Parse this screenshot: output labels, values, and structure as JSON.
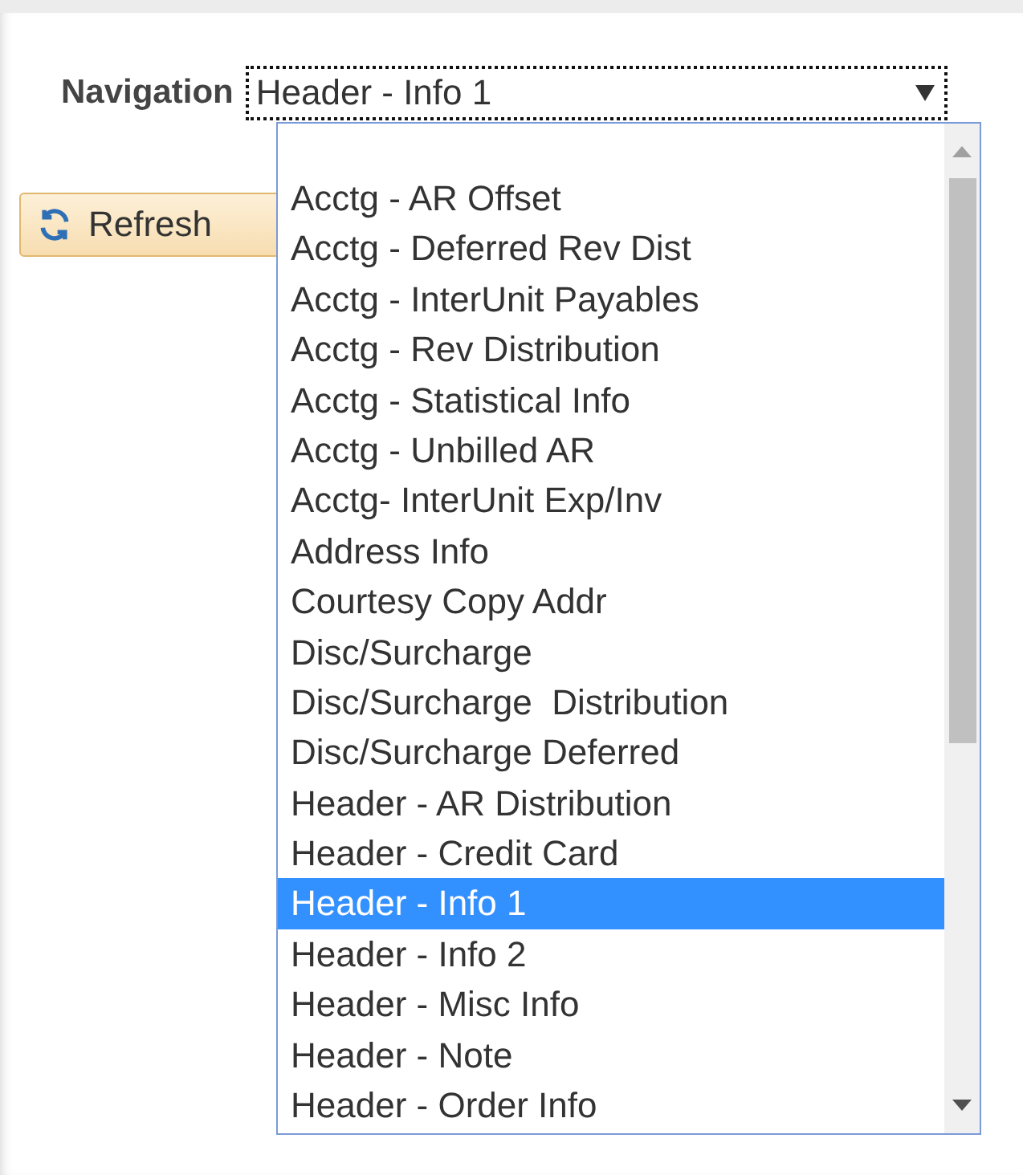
{
  "navigation": {
    "label": "Navigation",
    "value": "Header - Info 1"
  },
  "refresh_button": {
    "label": "Refresh"
  },
  "dropdown": {
    "options": [
      {
        "label": "Acctg - AR Offset",
        "selected": false
      },
      {
        "label": "Acctg - Deferred Rev Dist",
        "selected": false
      },
      {
        "label": "Acctg - InterUnit Payables",
        "selected": false
      },
      {
        "label": "Acctg - Rev Distribution",
        "selected": false
      },
      {
        "label": "Acctg - Statistical Info",
        "selected": false
      },
      {
        "label": "Acctg - Unbilled AR",
        "selected": false
      },
      {
        "label": "Acctg- InterUnit Exp/Inv",
        "selected": false
      },
      {
        "label": "Address Info",
        "selected": false
      },
      {
        "label": "Courtesy Copy Addr",
        "selected": false
      },
      {
        "label": "Disc/Surcharge",
        "selected": false
      },
      {
        "label": "Disc/Surcharge  Distribution",
        "selected": false
      },
      {
        "label": "Disc/Surcharge Deferred",
        "selected": false
      },
      {
        "label": "Header - AR Distribution",
        "selected": false
      },
      {
        "label": "Header - Credit Card",
        "selected": false
      },
      {
        "label": "Header - Info 1",
        "selected": true
      },
      {
        "label": "Header - Info 2",
        "selected": false
      },
      {
        "label": "Header - Misc Info",
        "selected": false
      },
      {
        "label": "Header - Note",
        "selected": false
      },
      {
        "label": "Header - Order Info",
        "selected": false
      }
    ]
  }
}
